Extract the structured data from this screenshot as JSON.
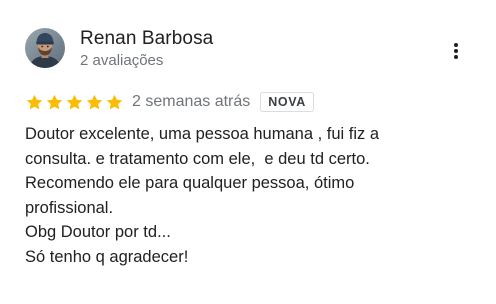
{
  "review": {
    "author_name": "Renan Barbosa",
    "author_meta": "2 avaliações",
    "rating": 5,
    "rating_max": 5,
    "date": "2 semanas atrás",
    "badge": "NOVA",
    "text_lines": [
      "Doutor excelente, uma pessoa humana , fui fiz a",
      "consulta. e tratamento com ele,  e deu td certo.",
      "Recomendo ele para qualquer pessoa, ótimo",
      "profissional.",
      "Obg Doutor por td...",
      "Só tenho q agradecer!"
    ],
    "more_icon": "more-vert-icon",
    "star_icon": "star-icon"
  },
  "colors": {
    "star": "#fbbc04",
    "text": "#202124",
    "secondary_text": "#70757a"
  }
}
